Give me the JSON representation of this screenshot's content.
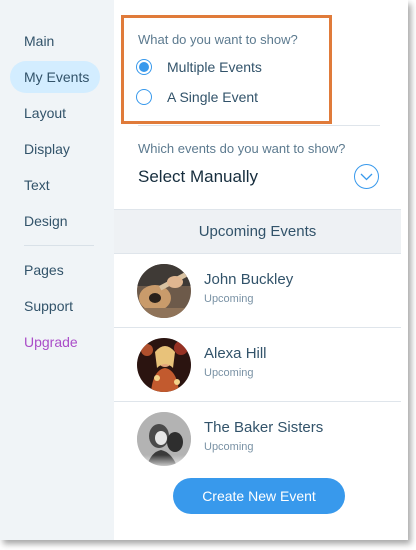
{
  "sidebar": {
    "items": [
      {
        "label": "Main"
      },
      {
        "label": "My Events"
      },
      {
        "label": "Layout"
      },
      {
        "label": "Display"
      },
      {
        "label": "Text"
      },
      {
        "label": "Design"
      },
      {
        "label": "Pages"
      },
      {
        "label": "Support"
      },
      {
        "label": "Upgrade"
      }
    ],
    "active": "My Events"
  },
  "show": {
    "question": "What do you want to show?",
    "options": [
      {
        "label": "Multiple Events",
        "selected": true
      },
      {
        "label": "A Single Event",
        "selected": false
      }
    ]
  },
  "which": {
    "question": "Which events do you want to show?",
    "value": "Select Manually",
    "toggle_icon": "chevron-down-icon"
  },
  "events": {
    "header": "Upcoming Events",
    "items": [
      {
        "name": "John Buckley",
        "status": "Upcoming"
      },
      {
        "name": "Alexa Hill",
        "status": "Upcoming"
      },
      {
        "name": "The Baker Sisters",
        "status": "Upcoming"
      }
    ]
  },
  "actions": {
    "create_label": "Create New Event"
  },
  "colors": {
    "accent": "#3899ec",
    "highlight_border": "#e07b3a",
    "upgrade": "#aa4dc8",
    "sidebar_bg": "#f0f4f7",
    "active_item_bg": "#d3edff"
  }
}
